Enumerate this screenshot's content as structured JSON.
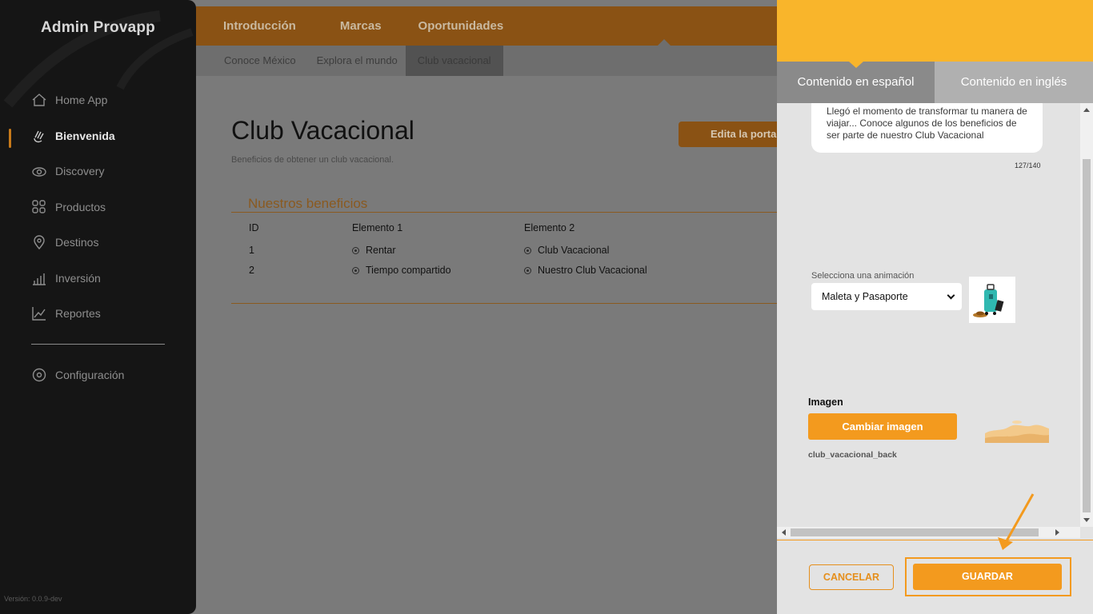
{
  "sidebar": {
    "brand": "Admin Provapp",
    "items": [
      {
        "label": "Home App"
      },
      {
        "label": "Bienvenida"
      },
      {
        "label": "Discovery"
      },
      {
        "label": "Productos"
      },
      {
        "label": "Destinos"
      },
      {
        "label": "Inversión"
      },
      {
        "label": "Reportes"
      },
      {
        "label": "Configuración"
      }
    ],
    "version": "Versión: 0.0.9-dev"
  },
  "topnav": {
    "tabs": [
      "Introducción",
      "Marcas",
      "Oportunidades"
    ],
    "subtabs": [
      "Conoce México",
      "Explora el mundo",
      "Club vacacional"
    ]
  },
  "main": {
    "title": "Club Vacacional",
    "subtitle": "Beneficios de obtener un club vacacional.",
    "edit_button": "Edita la portada",
    "section_title": "Nuestros beneficios",
    "table": {
      "headers": [
        "ID",
        "Elemento 1",
        "Elemento 2"
      ],
      "rows": [
        {
          "id": "1",
          "e1": "Rentar",
          "e2": "Club Vacacional"
        },
        {
          "id": "2",
          "e1": "Tiempo compartido",
          "e2": "Nuestro Club Vacacional"
        }
      ]
    }
  },
  "panel": {
    "tab_es": "Contenido en español",
    "tab_en": "Contenido en inglés",
    "text_value": "Llegó el momento de transformar tu manera de viajar... Conoce algunos de los beneficios de ser parte de nuestro Club Vacacional",
    "counter": "127/140",
    "animation_label": "Selecciona una animación",
    "animation_value": "Maleta y Pasaporte",
    "image_label": "Imagen",
    "change_image": "Cambiar imagen",
    "file_name": "club_vacacional_back",
    "cancel": "CANCELAR",
    "save": "GUARDAR"
  },
  "colors": {
    "accent": "#f39a1e",
    "panel_header": "#f9b52b",
    "sidebar_bg": "#151515"
  }
}
